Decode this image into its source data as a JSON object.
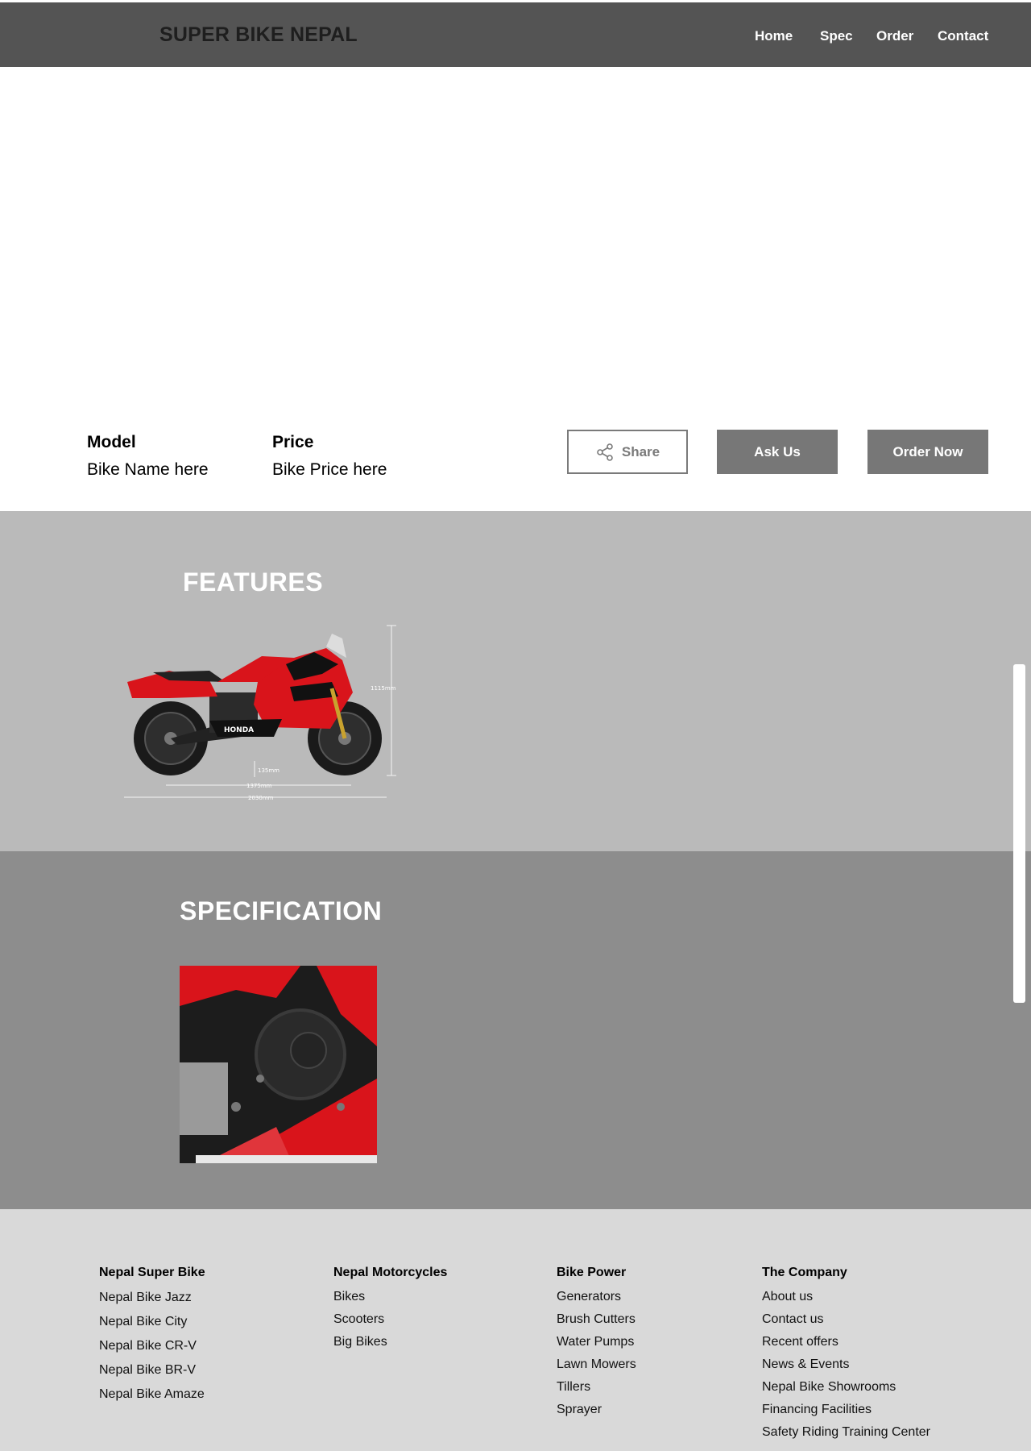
{
  "header": {
    "brand": "SUPER BIKE NEPAL",
    "nav": [
      "Home",
      "Spec",
      "Order",
      "Contact"
    ]
  },
  "info": {
    "model_label": "Model",
    "model_value": "Bike Name here",
    "price_label": "Price",
    "price_value": "Bike Price here"
  },
  "actions": {
    "share": "Share",
    "ask": "Ask Us",
    "order": "Order Now"
  },
  "features": {
    "title": "FEATURES",
    "dimensions": [
      "1115mm",
      "135mm",
      "1375mm",
      "2030mm"
    ],
    "brand_mark": "HONDA"
  },
  "specification": {
    "title": "SPECIFICATION"
  },
  "footer": {
    "columns": [
      {
        "heading": "Nepal Super Bike",
        "items": [
          "Nepal Bike Jazz",
          "Nepal Bike City",
          "Nepal Bike CR-V",
          "Nepal Bike BR-V",
          "Nepal Bike Amaze"
        ]
      },
      {
        "heading": "Nepal Motorcycles",
        "items": [
          "Bikes",
          "Scooters",
          "Big Bikes"
        ]
      },
      {
        "heading": "Bike Power",
        "items": [
          "Generators",
          "Brush Cutters",
          "Water Pumps",
          "Lawn Mowers",
          "Tillers",
          "Sprayer"
        ]
      },
      {
        "heading": "The Company",
        "items": [
          "About us",
          "Contact us",
          "Recent offers",
          "News & Events",
          "Nepal Bike Showrooms",
          "Financing Facilities",
          "Safety Riding Training Center"
        ]
      }
    ]
  },
  "colors": {
    "topbar": "#545454",
    "features_bg": "#bababa",
    "spec_bg": "#8d8d8d",
    "footer_bg": "#d9d9d9",
    "button": "#777777",
    "bike_red": "#d9141b"
  }
}
